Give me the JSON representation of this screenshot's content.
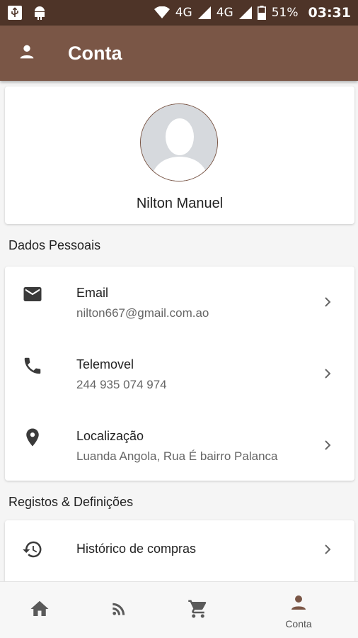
{
  "status_bar": {
    "network_1": "4G",
    "network_2": "4G",
    "battery": "51%",
    "time": "03:31",
    "icons": [
      "usb-icon",
      "android-icon",
      "wifi-icon",
      "signal-icon",
      "battery-icon"
    ]
  },
  "app_bar": {
    "title": "Conta",
    "icon": "person-icon",
    "background": "#7a5646"
  },
  "profile": {
    "name": "Nilton Manuel",
    "avatar_icon": "avatar-placeholder"
  },
  "personal_section": {
    "title": "Dados Pessoais",
    "items": [
      {
        "icon": "email-icon",
        "label": "Email",
        "value": "nilton667@gmail.com.ao"
      },
      {
        "icon": "phone-icon",
        "label": "Telemovel",
        "value": "244 935 074 974"
      },
      {
        "icon": "location-icon",
        "label": "Localização",
        "value": "Luanda Angola, Rua É bairro Palanca"
      }
    ]
  },
  "settings_section": {
    "title": "Registos & Definições",
    "items": [
      {
        "icon": "history-icon",
        "label": "Histórico de compras"
      }
    ]
  },
  "bottom_nav": {
    "items": [
      {
        "icon": "home-icon",
        "label": ""
      },
      {
        "icon": "rss-feed-icon",
        "label": ""
      },
      {
        "icon": "cart-icon",
        "label": ""
      },
      {
        "icon": "person-icon",
        "label": "Conta",
        "active": true
      }
    ],
    "active_color": "#7a5646"
  }
}
